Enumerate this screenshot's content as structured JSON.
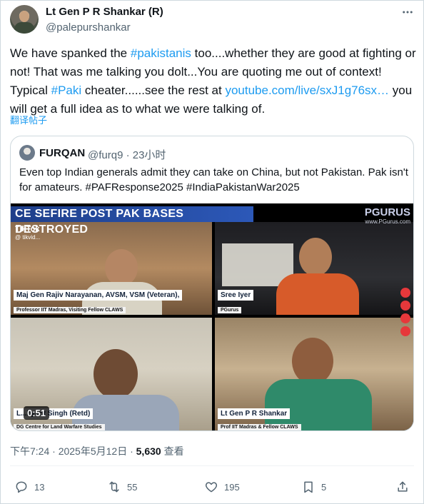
{
  "author": {
    "name": "Lt Gen P R Shankar (R)",
    "handle": "@palepurshankar"
  },
  "tweet": {
    "segments": [
      {
        "t": "We have spanked the ",
        "link": false
      },
      {
        "t": "#pakistanis",
        "link": true
      },
      {
        "t": " too....whether they are good at fighting or not! That was me talking you dolt...You are quoting me out of context! Typical ",
        "link": false
      },
      {
        "t": "#Paki",
        "link": true
      },
      {
        "t": " cheater......see the rest at ",
        "link": false
      },
      {
        "t": "youtube.com/live/sxJ1g76sx…",
        "link": true
      },
      {
        "t": " you will get a full idea as to what we were talking of.",
        "link": false
      }
    ],
    "translate_label": "翻译帖子"
  },
  "quote": {
    "name": "FURQAN",
    "handle": "@furq9 · 23小时",
    "text": "Even top Indian generals admit they can take on China, but not Pakistan. Pak isn't for amateurs. #PAFResponse2025 #IndiaPakistanWar2025",
    "video": {
      "banner": "CEASEFIRE POST PAK BASES DESTROYED",
      "banner_visible": "CE  SEFIRE POST PAK BASES DESTROYED",
      "logo": "PGURUS",
      "logo_url": "www.PGurus.com",
      "tiktok": "TikTok",
      "tiktok_handle": "@ tikvid...",
      "duration": "0:51",
      "panels": [
        {
          "name": "Maj Gen Rajiv Narayanan, AVSM, VSM (Veteran),",
          "sub": "Professor IIT Madras, Visiting Fellow CLAWS"
        },
        {
          "name": "Sree Iyer",
          "sub": "PGurus"
        },
        {
          "name": "L...hyant Singh (Retd)",
          "sub": "DG Centre for Land Warfare Studies"
        },
        {
          "name": "Lt Gen P R Shankar",
          "sub": "Prof IIT Madras & Fellow CLAWS"
        }
      ]
    }
  },
  "meta": {
    "time": "下午7:24 · 2025年5月12日 · ",
    "views_count": "5,630",
    "views_label": " 查看"
  },
  "actions": {
    "replies": "13",
    "reposts": "55",
    "likes": "195",
    "bookmarks": "5"
  },
  "icons": [
    "more-icon",
    "reply-icon",
    "repost-icon",
    "like-icon",
    "bookmark-icon",
    "share-icon"
  ],
  "colors": {
    "link": "#1d9bf0",
    "muted": "#536471",
    "text": "#0f1419"
  }
}
